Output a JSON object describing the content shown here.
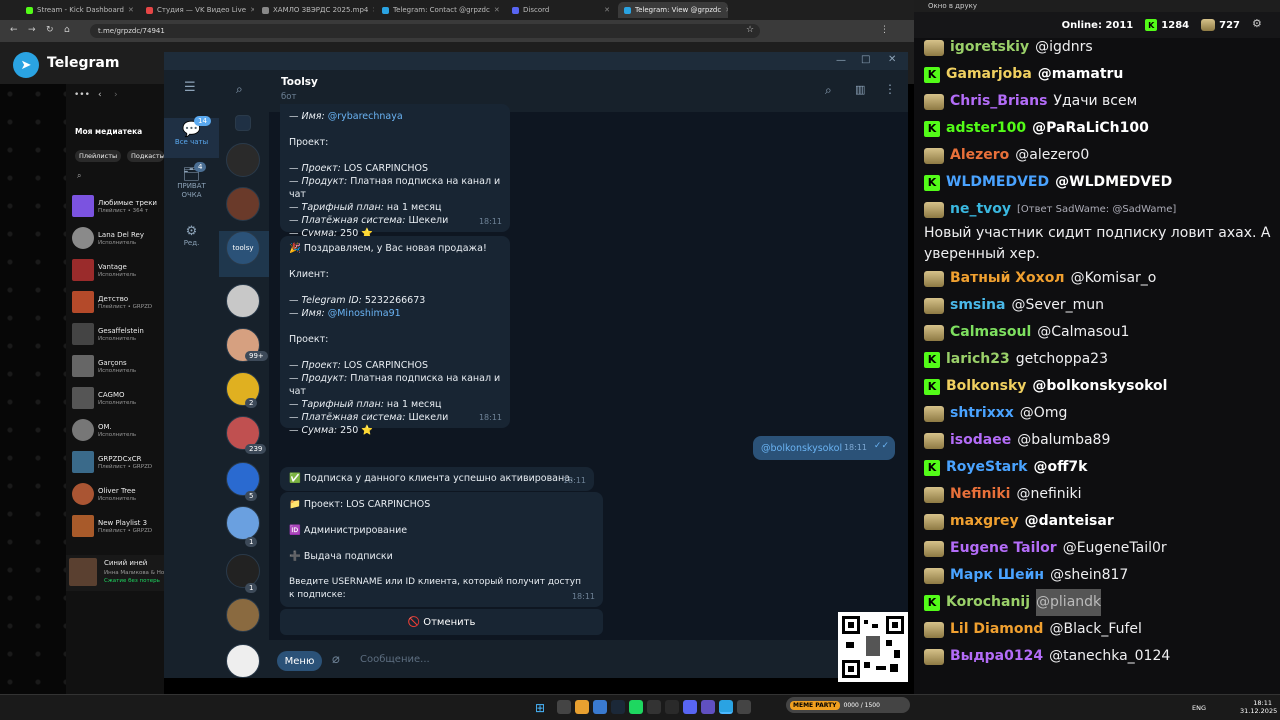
{
  "browser": {
    "tabs": [
      {
        "label": "Stream - Kick Dashboard",
        "color": "#53fc18"
      },
      {
        "label": "Студия — VK Видео Live",
        "color": "#e64646"
      },
      {
        "label": "ХАМЛО ЗВЭРДС 2025.mp4",
        "color": "#888888"
      },
      {
        "label": "Telegram: Contact @grpzdc",
        "color": "#2aa3e2"
      },
      {
        "label": "Discord",
        "color": "#5865f2"
      },
      {
        "label": "Telegram: View @grpzdc",
        "color": "#2aa3e2"
      }
    ],
    "url": "t.me/grpzdc/74941",
    "brand": "Telegram"
  },
  "spotify": {
    "header": "Моя медиатека",
    "filters": [
      "Плейлисты",
      "Подкасты"
    ],
    "items": [
      {
        "title": "Любимые треки",
        "sub": "Плейлист • 364 т",
        "color": "#7b53e0"
      },
      {
        "title": "Lana Del Rey",
        "sub": "Исполнитель",
        "color": "#8a8a8a"
      },
      {
        "title": "Vantage",
        "sub": "Исполнитель",
        "color": "#9a2b2b"
      },
      {
        "title": "Детство",
        "sub": "Плейлист • GRPZD",
        "color": "#b44a2a"
      },
      {
        "title": "Gesaffelstein",
        "sub": "Исполнитель",
        "color": "#444444"
      },
      {
        "title": "Garçons",
        "sub": "Исполнитель",
        "color": "#666666"
      },
      {
        "title": "CAGMO",
        "sub": "Исполнитель",
        "color": "#555555"
      },
      {
        "title": "OM.",
        "sub": "Исполнитель",
        "color": "#777777"
      },
      {
        "title": "GRPZDCxCR",
        "sub": "Плейлист • GRPZD",
        "color": "#3a6a8a"
      },
      {
        "title": "Oliver Tree",
        "sub": "Исполнитель",
        "color": "#aa5533"
      },
      {
        "title": "New Playlist 3",
        "sub": "Плейлист • GRPZD",
        "color": "#a85a2a"
      }
    ],
    "now_playing": {
      "title": "Синий иней",
      "artist": "Инна Маликова & Нов",
      "status": "Сжатие без потерь"
    }
  },
  "telegram": {
    "chat_title": "Toolsy",
    "chat_subtitle": "бот",
    "rail": [
      {
        "label": "Все чаты",
        "badge": "14"
      },
      {
        "label": "ПРИВАТ ОЧКА",
        "badge": "4"
      },
      {
        "label": "Ред."
      }
    ],
    "chat_badges": [
      "99+",
      "2",
      "239",
      "5",
      "1",
      "1"
    ],
    "msg1": {
      "name_line": "— Имя: ",
      "name_link": "@rybarechnaya",
      "project_header": "Проект:",
      "lines": [
        [
          "— Проект:",
          " LOS CARPINCHOS"
        ],
        [
          "— Продукт:",
          " Платная подписка на канал и чат"
        ],
        [
          "— Тарифный план:",
          " на 1 месяц"
        ],
        [
          "— Платёжная система:",
          " Шекели"
        ],
        [
          "— Сумма:",
          " 250 ⭐"
        ]
      ],
      "time": "18:11"
    },
    "msg2": {
      "head": "🎉 Поздравляем, у Вас новая продажа!",
      "client": "Клиент:",
      "id_line_label": "— Telegram ID:",
      "id_line_value": " 5232266673",
      "name_line": "— Имя: ",
      "name_link": "@Minoshima91",
      "project_header": "Проект:",
      "lines": [
        [
          "— Проект:",
          " LOS CARPINCHOS"
        ],
        [
          "— Продукт:",
          " Платная подписка на канал и чат"
        ],
        [
          "— Тарифный план:",
          " на 1 месяц"
        ],
        [
          "— Платёжная система:",
          " Шекели"
        ],
        [
          "— Сумма:",
          " 250 ⭐"
        ]
      ],
      "time": "18:11"
    },
    "outgoing": {
      "text": "@bolkonskysokol",
      "time": "18:11"
    },
    "activated": {
      "text": "✅ Подписка у данного клиента успешно активирована.",
      "time": "18:11"
    },
    "msg3": {
      "project": "📁 Проект: LOS CARPINCHOS",
      "admin": "🆔 Администрирование",
      "issue": "➕ Выдача подписки",
      "prompt": "Введите USERNAME или ID клиента, который получит доступ к подписке:",
      "time": "18:11"
    },
    "cancel_label": "🚫 Отменить",
    "menu_label": "Меню",
    "input_placeholder": "Сообщение..."
  },
  "stream_chat": {
    "window_title": "Окно в друку",
    "online_label": "Online:",
    "online_count": "2011",
    "kick_count": "1284",
    "other_count": "727",
    "messages": [
      {
        "badge": "c",
        "name": "igoretskiy",
        "color": "#9ad069",
        "text": "@igdnrs",
        "mention": false
      },
      {
        "badge": "k",
        "name": "Gamarjoba",
        "color": "#f0d060",
        "text": "@mamatru",
        "mention": true
      },
      {
        "badge": "c",
        "name": "Chris_Brians",
        "color": "#b36cf7",
        "text": "Удачи всем",
        "mention": false
      },
      {
        "badge": "k",
        "name": "adster100",
        "color": "#53fc18",
        "text": "@PaRaLiCh100",
        "mention": true
      },
      {
        "badge": "c",
        "name": "Alezero",
        "color": "#e8703a",
        "text": "@alezero0",
        "mention": false
      },
      {
        "badge": "k",
        "name": "WLDMEDVED",
        "color": "#4aa3ff",
        "text": "@WLDMEDVED",
        "mention": true
      },
      {
        "badge": "c",
        "name": "ne_tvoy",
        "color": "#3ab8e0",
        "text": "[Ответ SadWame: @SadWame]",
        "mention": false,
        "reply": true
      },
      {
        "badge": "",
        "name": "",
        "color": "#efeff1",
        "text": "Новый участник сидит подписку ловит ахах. А ты",
        "mention": false
      },
      {
        "badge": "",
        "name": "",
        "color": "#efeff1",
        "text": "уверенный хер.",
        "mention": false
      },
      {
        "badge": "c",
        "name": "Ватный Хохол",
        "color": "#f0a030",
        "text": "@Komisar_o",
        "mention": false
      },
      {
        "badge": "c",
        "name": "smsina",
        "color": "#4ab8e8",
        "text": "@Sever_mun",
        "mention": false
      },
      {
        "badge": "c",
        "name": "Calmasoul",
        "color": "#7ee060",
        "text": "@Calmasou1",
        "mention": false
      },
      {
        "badge": "k",
        "name": "larich23",
        "color": "#9ad069",
        "text": "getchoppa23",
        "mention": false
      },
      {
        "badge": "k",
        "name": "Bolkonsky",
        "color": "#f0d060",
        "text": "@bolkonskysokol",
        "mention": true
      },
      {
        "badge": "c",
        "name": "shtrixxx",
        "color": "#4aa3ff",
        "text": "@Omg",
        "mention": false
      },
      {
        "badge": "c",
        "name": "isodaee",
        "color": "#b36cf7",
        "text": "@balumba89",
        "mention": false
      },
      {
        "badge": "k",
        "name": "RoyeStark",
        "color": "#4aa3ff",
        "text": "@off7k",
        "mention": true
      },
      {
        "badge": "c",
        "name": "Nefiniki",
        "color": "#e8703a",
        "text": "@nefiniki",
        "mention": false
      },
      {
        "badge": "c",
        "name": "maxgrey",
        "color": "#f0a030",
        "text": "@danteisar",
        "mention": true
      },
      {
        "badge": "c",
        "name": "Eugene Tailor",
        "color": "#b36cf7",
        "text": "@EugeneTail0r",
        "mention": false
      },
      {
        "badge": "c",
        "name": "Марк Шейн",
        "color": "#4aa3ff",
        "text": "@shein817",
        "mention": false
      },
      {
        "badge": "k",
        "name": "Korochanij",
        "color": "#9ad069",
        "text": "@pliandk",
        "mention": false,
        "highlight": true
      },
      {
        "badge": "c",
        "name": "Lil Diamond",
        "color": "#f0a030",
        "text": "@Black_Fufel",
        "mention": false
      },
      {
        "badge": "c",
        "name": "Выдра0124",
        "color": "#b36cf7",
        "text": "@tanechka_0124",
        "mention": false
      }
    ]
  },
  "taskbar": {
    "lang": "ENG",
    "time": "18:11",
    "date": "31.12.2025",
    "meme_label": "MEME PARTY",
    "meme_value": "0000 / 1500"
  }
}
